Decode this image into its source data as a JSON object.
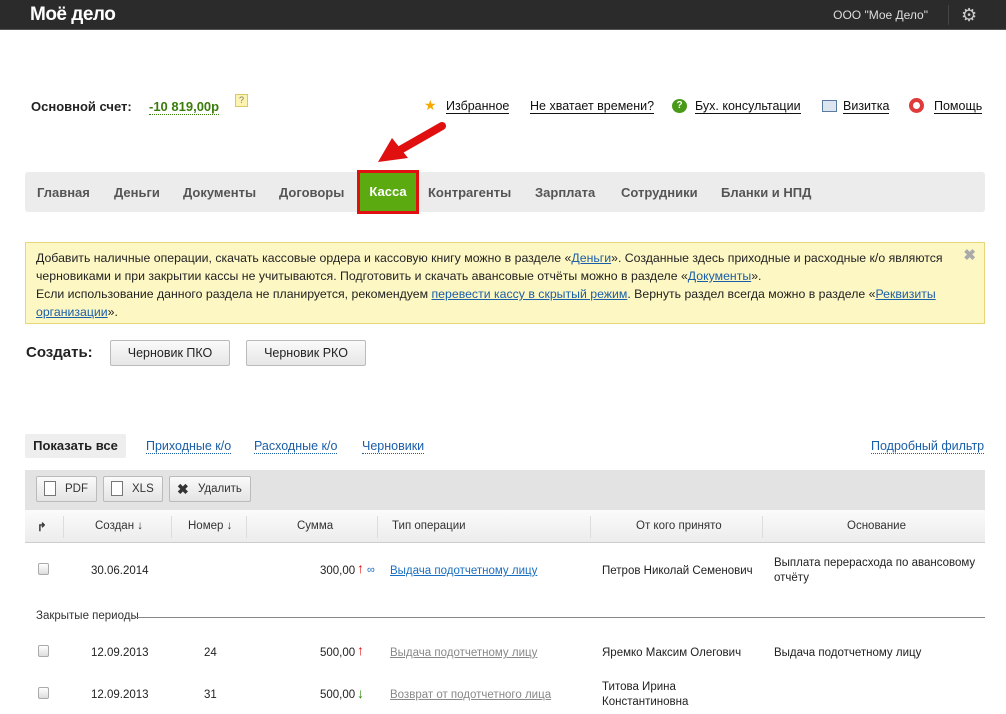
{
  "header": {
    "logo": "Моё дело",
    "org": "ООО \"Мое Дело\""
  },
  "account": {
    "label": "Основной счет:",
    "value": "-10 819,00р",
    "help": "?"
  },
  "toplinks": [
    {
      "label": "Избранное",
      "icon": "star-icon"
    },
    {
      "label": "Не хватает времени?"
    },
    {
      "label": "Бух. консультации",
      "icon": "chat-icon"
    },
    {
      "label": "Визитка",
      "icon": "card-icon"
    },
    {
      "label": "Помощь",
      "icon": "lifebuoy-icon"
    }
  ],
  "nav": [
    "Главная",
    "Деньги",
    "Документы",
    "Договоры",
    "Касса",
    "Контрагенты",
    "Зарплата",
    "Сотрудники",
    "Бланки и НПД"
  ],
  "notice": {
    "t1": "Добавить наличные операции, скачать кассовые ордера и кассовую книгу можно в разделе «",
    "l1": "Деньги",
    "t2": "». Созданные здесь приходные и расходные к/о являются черновиками и при закрытии кассы не учитываются. Подготовить и скачать авансовые отчёты можно в разделе «",
    "l2": "Документы",
    "t3": "».",
    "t4": "Если использование данного раздела не планируется, рекомендуем ",
    "l3": "перевести кассу в скрытый режим",
    "t5": ". Вернуть раздел всегда можно в разделе «",
    "l4": "Реквизиты организации",
    "t6": "»."
  },
  "create": {
    "label": "Создать:",
    "pko": "Черновик ПКО",
    "rko": "Черновик РКО"
  },
  "filters": {
    "all": "Показать все",
    "income": "Приходные к/о",
    "expense": "Расходные к/о",
    "drafts": "Черновики",
    "detailed": "Подробный фильтр"
  },
  "toolbar": {
    "pdf": "PDF",
    "xls": "XLS",
    "delete": "Удалить"
  },
  "columns": [
    "Создан ↓",
    "Номер ↓",
    "Сумма",
    "Тип операции",
    "От кого принято",
    "Основание"
  ],
  "rows": [
    {
      "date": "30.06.2014",
      "number": "",
      "sum": "300,00",
      "dir": "↑",
      "type": "Выдача подотчетному лицу",
      "from": "Петров Николай Семенович",
      "basis": "Выплата перерасхода по авансовому отчёту"
    }
  ],
  "closed_label": "Закрытые периоды",
  "closed_rows": [
    {
      "date": "12.09.2013",
      "number": "24",
      "sum": "500,00",
      "dir": "↑",
      "type": "Выдача подотчетному лицу",
      "from": "Яремко Максим Олегович",
      "basis": "Выдача подотчетному лицу"
    },
    {
      "date": "12.09.2013",
      "number": "31",
      "sum": "500,00",
      "dir": "↓",
      "type": "Возврат от подотчетного лица",
      "from": "Титова Ирина Константиновна",
      "basis": ""
    }
  ]
}
